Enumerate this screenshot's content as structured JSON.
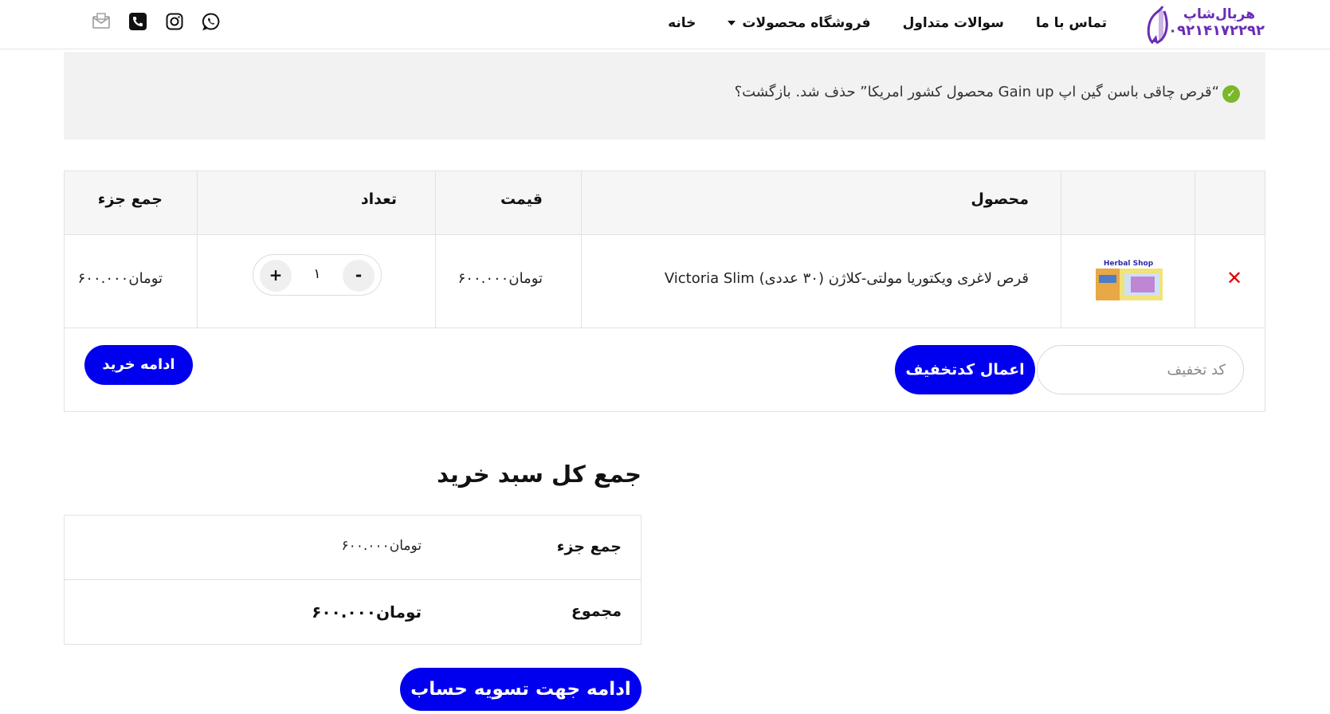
{
  "header": {
    "logo_name": "هربال‌شاپ",
    "logo_phone": "۰۹۲۱۴۱۷۲۲۹۲",
    "nav": [
      {
        "label": "خانه"
      },
      {
        "label": "فروشگاه محصولات"
      },
      {
        "label": "سوالات متداول"
      },
      {
        "label": "تماس با ما"
      }
    ],
    "social_icons": [
      "whatsapp-icon",
      "instagram-icon",
      "phone-icon",
      "email-icon"
    ]
  },
  "notice": {
    "text": "“قرص چاقی باسن گین اپ Gain up محصول کشور امریکا” حذف شد. بازگشت؟",
    "status_color": "#7ab829"
  },
  "cart": {
    "columns": {
      "product": "محصول",
      "price": "قیمت",
      "quantity": "تعداد",
      "subtotal": "جمع جزء"
    },
    "items": [
      {
        "name": "قرص لاغری ویکتوریا مولتی-کلاژن (۳۰ عددی) Victoria Slim",
        "price": "تومان۶۰۰.۰۰۰",
        "quantity": "۱",
        "subtotal": "تومان۶۰۰.۰۰۰",
        "thumb_brand": "Herbal Shop"
      }
    ],
    "qty_minus": "-",
    "qty_plus": "+",
    "coupon_placeholder": "کد تخفیف",
    "apply_coupon_label": "اعمال کدتخفیف",
    "update_cart_label": "ادامه خرید"
  },
  "totals": {
    "title": "جمع کل سبد خرید",
    "subtotal_label": "جمع جزء",
    "subtotal_value": "تومان۶۰۰.۰۰۰",
    "total_label": "مجموع",
    "total_value": "تومان۶۰۰.۰۰۰",
    "checkout_label": "ادامه جهت تسویه حساب"
  },
  "colors": {
    "accent": "#0000ee",
    "brand": "#6a2db5",
    "remove": "#e00000"
  }
}
